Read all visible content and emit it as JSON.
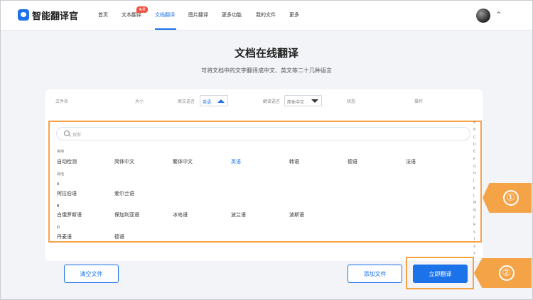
{
  "nav": {
    "logo": "智能翻译官",
    "items": [
      "首页",
      "文本翻译",
      "文档翻译",
      "图片翻译",
      "更多功能",
      "我的文件",
      "更多"
    ],
    "badge": "免费"
  },
  "heading": {
    "title": "文档在线翻译",
    "subtitle": "可将文档中的文字翻译成中文、英文等二十几种语言"
  },
  "table": {
    "headers": [
      "文件名",
      "大小",
      "原文语言",
      "翻译语言",
      "状态",
      "操作"
    ],
    "source_lang": "英语",
    "target_lang": "简体中文"
  },
  "language_panel": {
    "search_placeholder": "搜索",
    "common_label": "常用",
    "common": [
      "自动检测",
      "简体中文",
      "繁体中文",
      "英语",
      "韩语",
      "德语",
      "法语"
    ],
    "selected": "英语",
    "other_label": "其他",
    "groups": [
      {
        "letter": "A",
        "languages": [
          "阿拉伯语",
          "爱尔兰语"
        ]
      },
      {
        "letter": "B",
        "languages": [
          "白俄罗斯语",
          "保加利亚语",
          "冰岛语",
          "波兰语",
          "波斯语"
        ]
      },
      {
        "letter": "D",
        "languages": [
          "丹麦语",
          "德语"
        ]
      }
    ],
    "alphabet": [
      "A",
      "B",
      "C",
      "D",
      "E",
      "F",
      "G",
      "H",
      "J",
      "K",
      "L",
      "M",
      "N",
      "P",
      "R",
      "S",
      "T",
      "X",
      "Y"
    ]
  },
  "actions": {
    "clear": "清空文件",
    "add": "添加文件",
    "translate": "立即翻译"
  },
  "callouts": [
    "①",
    "②"
  ],
  "colors": {
    "accent": "#1c72e8",
    "highlight": "#f5a347",
    "badge": "#f04b3b"
  }
}
